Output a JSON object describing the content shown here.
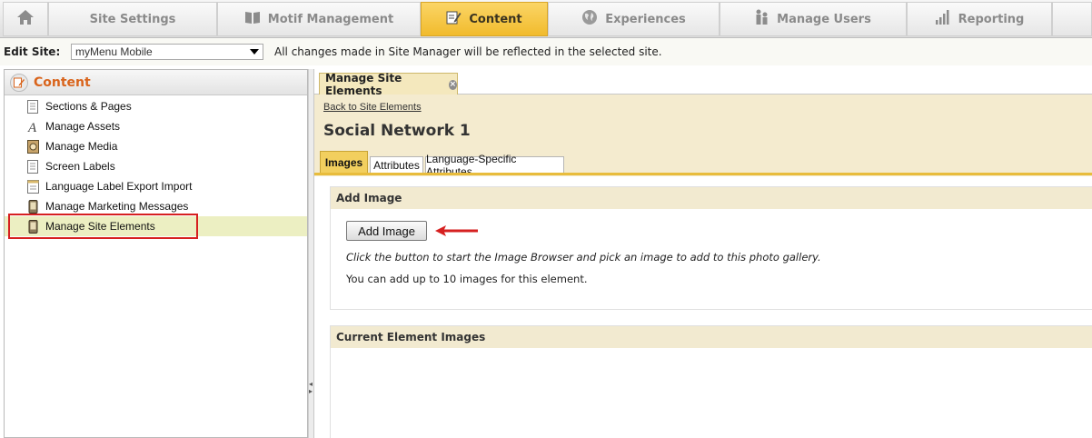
{
  "nav": {
    "tabs": [
      {
        "label": "Site Settings",
        "icon": "gear-icon"
      },
      {
        "label": "Motif Management",
        "icon": "book-icon"
      },
      {
        "label": "Content",
        "icon": "pencil-document-icon",
        "active": true
      },
      {
        "label": "Experiences",
        "icon": "globe-icon"
      },
      {
        "label": "Manage Users",
        "icon": "users-icon"
      },
      {
        "label": "Reporting",
        "icon": "bar-chart-icon"
      }
    ],
    "active_color": "#f1bb2d"
  },
  "site_bar": {
    "label": "Edit Site:",
    "selected_site": "myMenu Mobile",
    "note": "All changes made in Site Manager will be reflected in the selected site."
  },
  "left_panel": {
    "title": "Content",
    "items": [
      {
        "label": "Sections & Pages",
        "icon": "page-icon"
      },
      {
        "label": "Manage Assets",
        "icon": "font-asset-icon"
      },
      {
        "label": "Manage Media",
        "icon": "media-icon"
      },
      {
        "label": "Screen Labels",
        "icon": "page-icon"
      },
      {
        "label": "Language Label Export Import",
        "icon": "list-page-icon"
      },
      {
        "label": "Manage Marketing Messages",
        "icon": "phone-icon"
      },
      {
        "label": "Manage Site Elements",
        "icon": "phone-icon",
        "selected": true
      }
    ]
  },
  "main": {
    "doc_tab": "Manage Site Elements",
    "back_link": "Back to Site Elements",
    "title": "Social Network 1",
    "subtabs": [
      {
        "label": "Images",
        "active": true
      },
      {
        "label": "Attributes"
      },
      {
        "label": "Language-Specific Attributes"
      }
    ],
    "add_section": {
      "heading": "Add Image",
      "button": "Add Image",
      "help": "Click the button to start the Image Browser and pick an image to add to this photo gallery.",
      "limit_note": "You can add up to 10 images for this element."
    },
    "current_section": {
      "heading": "Current Element Images"
    },
    "annotation_color": "#d62020"
  }
}
